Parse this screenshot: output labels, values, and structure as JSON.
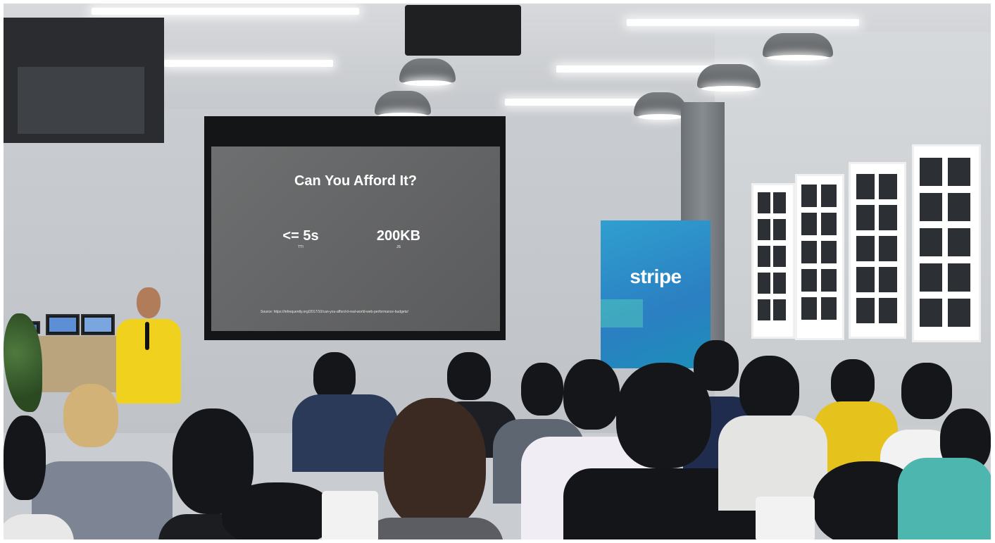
{
  "slide": {
    "title": "Can You Afford It?",
    "metric_time_value": "<= 5s",
    "metric_time_sub": "TTI",
    "metric_size_value": "200KB",
    "metric_size_sub": "JS",
    "source": "Source: https://infrequently.org/2017/10/can-you-afford-it-real-world-web-performance-budgets/"
  },
  "banner": {
    "logo": "stripe",
    "color": "#2b8fd0"
  },
  "speaker": {
    "shirt_color": "#f0d21e"
  }
}
